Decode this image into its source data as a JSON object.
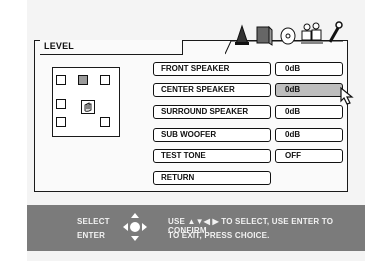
{
  "panel": {
    "title": "LEVEL"
  },
  "rows": [
    {
      "label": "FRONT SPEAKER",
      "value": "0dB"
    },
    {
      "label": "CENTER SPEAKER",
      "value": "0dB"
    },
    {
      "label": "SURROUND SPEAKER",
      "value": "0dB"
    },
    {
      "label": "SUB WOOFER",
      "value": "0dB"
    },
    {
      "label": "TEST TONE",
      "value": "OFF"
    },
    {
      "label": "RETURN",
      "value": ""
    }
  ],
  "selected_row": "CENTER SPEAKER",
  "tab_icons": [
    "speaker-tab-icon",
    "screen-tab-icon",
    "disc-tab-icon",
    "people-tab-icon",
    "wrench-tab-icon"
  ],
  "footer": {
    "select_label": "SELECT",
    "enter_label": "ENTER",
    "line1": "USE ▲▼◀ ▶ TO SELECT, USE ENTER TO CONFIRM",
    "line2": "TO EXIT, PRESS CHOICE."
  },
  "colors": {
    "selected_value_bg": "#bdbdbd",
    "footer_bg": "#7b7b7b"
  }
}
